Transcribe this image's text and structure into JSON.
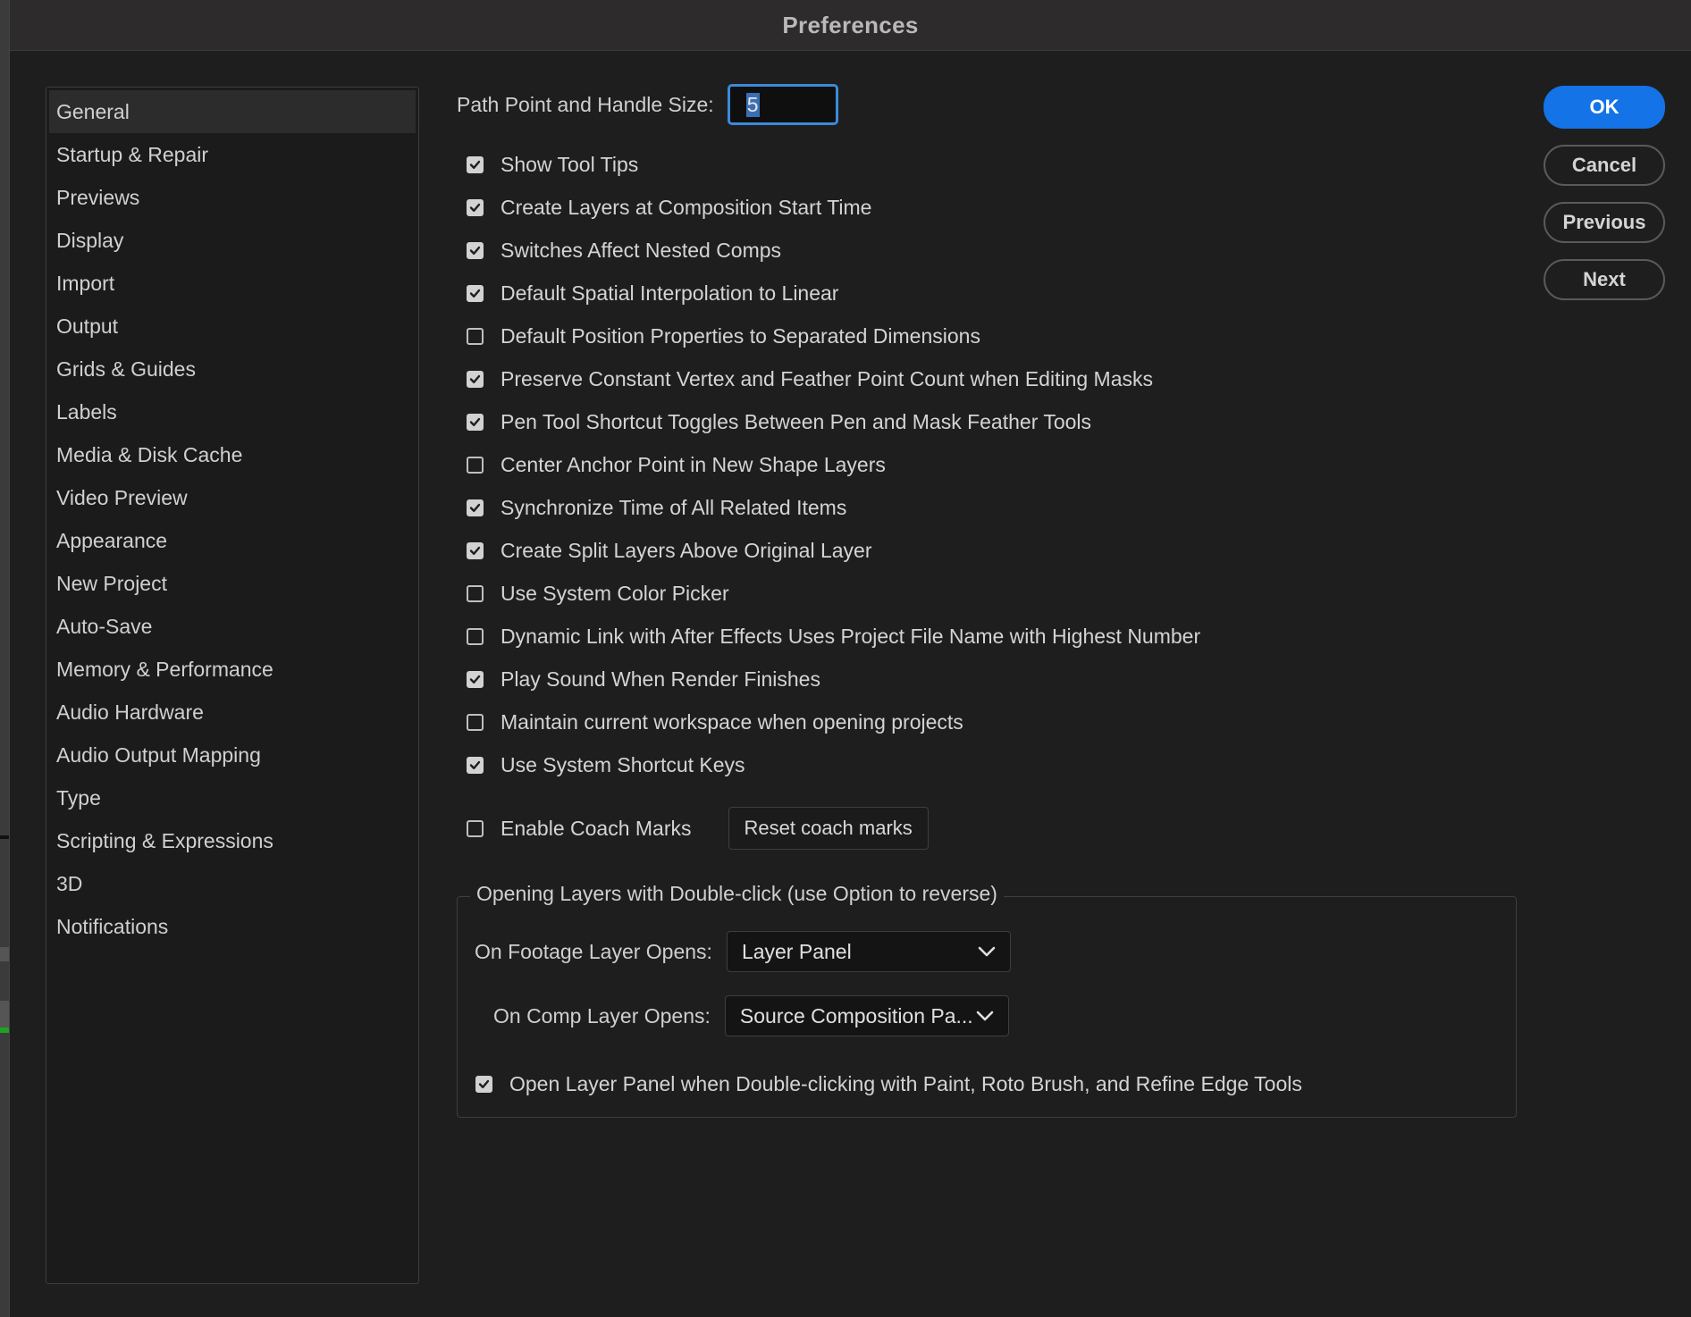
{
  "window": {
    "title": "Preferences"
  },
  "sidebar": {
    "items": [
      {
        "label": "General",
        "selected": true
      },
      {
        "label": "Startup & Repair"
      },
      {
        "label": "Previews"
      },
      {
        "label": "Display"
      },
      {
        "label": "Import"
      },
      {
        "label": "Output"
      },
      {
        "label": "Grids & Guides"
      },
      {
        "label": "Labels"
      },
      {
        "label": "Media & Disk Cache"
      },
      {
        "label": "Video Preview"
      },
      {
        "label": "Appearance"
      },
      {
        "label": "New Project"
      },
      {
        "label": "Auto-Save"
      },
      {
        "label": "Memory & Performance"
      },
      {
        "label": "Audio Hardware"
      },
      {
        "label": "Audio Output Mapping"
      },
      {
        "label": "Type"
      },
      {
        "label": "Scripting & Expressions"
      },
      {
        "label": "3D"
      },
      {
        "label": "Notifications"
      }
    ]
  },
  "general": {
    "path_point_label": "Path Point and Handle Size:",
    "path_point_value": "5",
    "options": [
      {
        "label": "Show Tool Tips",
        "checked": true
      },
      {
        "label": "Create Layers at Composition Start Time",
        "checked": true
      },
      {
        "label": "Switches Affect Nested Comps",
        "checked": true
      },
      {
        "label": "Default Spatial Interpolation to Linear",
        "checked": true
      },
      {
        "label": "Default Position Properties to Separated Dimensions",
        "checked": false
      },
      {
        "label": "Preserve Constant Vertex and Feather Point Count when Editing Masks",
        "checked": true
      },
      {
        "label": "Pen Tool Shortcut Toggles Between Pen and Mask Feather Tools",
        "checked": true
      },
      {
        "label": "Center Anchor Point in New Shape Layers",
        "checked": false
      },
      {
        "label": "Synchronize Time of All Related Items",
        "checked": true
      },
      {
        "label": "Create Split Layers Above Original Layer",
        "checked": true
      },
      {
        "label": "Use System Color Picker",
        "checked": false
      },
      {
        "label": "Dynamic Link with After Effects Uses Project File Name with Highest Number",
        "checked": false
      },
      {
        "label": "Play Sound When Render Finishes",
        "checked": true
      },
      {
        "label": "Maintain current workspace when opening projects",
        "checked": false
      },
      {
        "label": "Use System Shortcut Keys",
        "checked": true
      }
    ],
    "coach": {
      "label": "Enable Coach Marks",
      "checked": false,
      "reset_label": "Reset coach marks"
    },
    "double_click_group": {
      "legend": "Opening Layers with Double-click (use Option to reverse)",
      "footage_label": "On Footage Layer Opens:",
      "footage_value": "Layer Panel",
      "comp_label": "On Comp Layer Opens:",
      "comp_value": "Source Composition Pa...",
      "paint_option": {
        "label": "Open Layer Panel when Double-clicking with Paint, Roto Brush, and Refine Edge Tools",
        "checked": true
      }
    }
  },
  "buttons": {
    "ok": "OK",
    "cancel": "Cancel",
    "previous": "Previous",
    "next": "Next"
  },
  "colors": {
    "accent": "#1473e6",
    "focus_ring": "#3b8ad9",
    "background": "#1e1e1e"
  },
  "icons": {
    "checkmark": "checkmark-icon",
    "dropdown": "chevron-down-icon"
  }
}
